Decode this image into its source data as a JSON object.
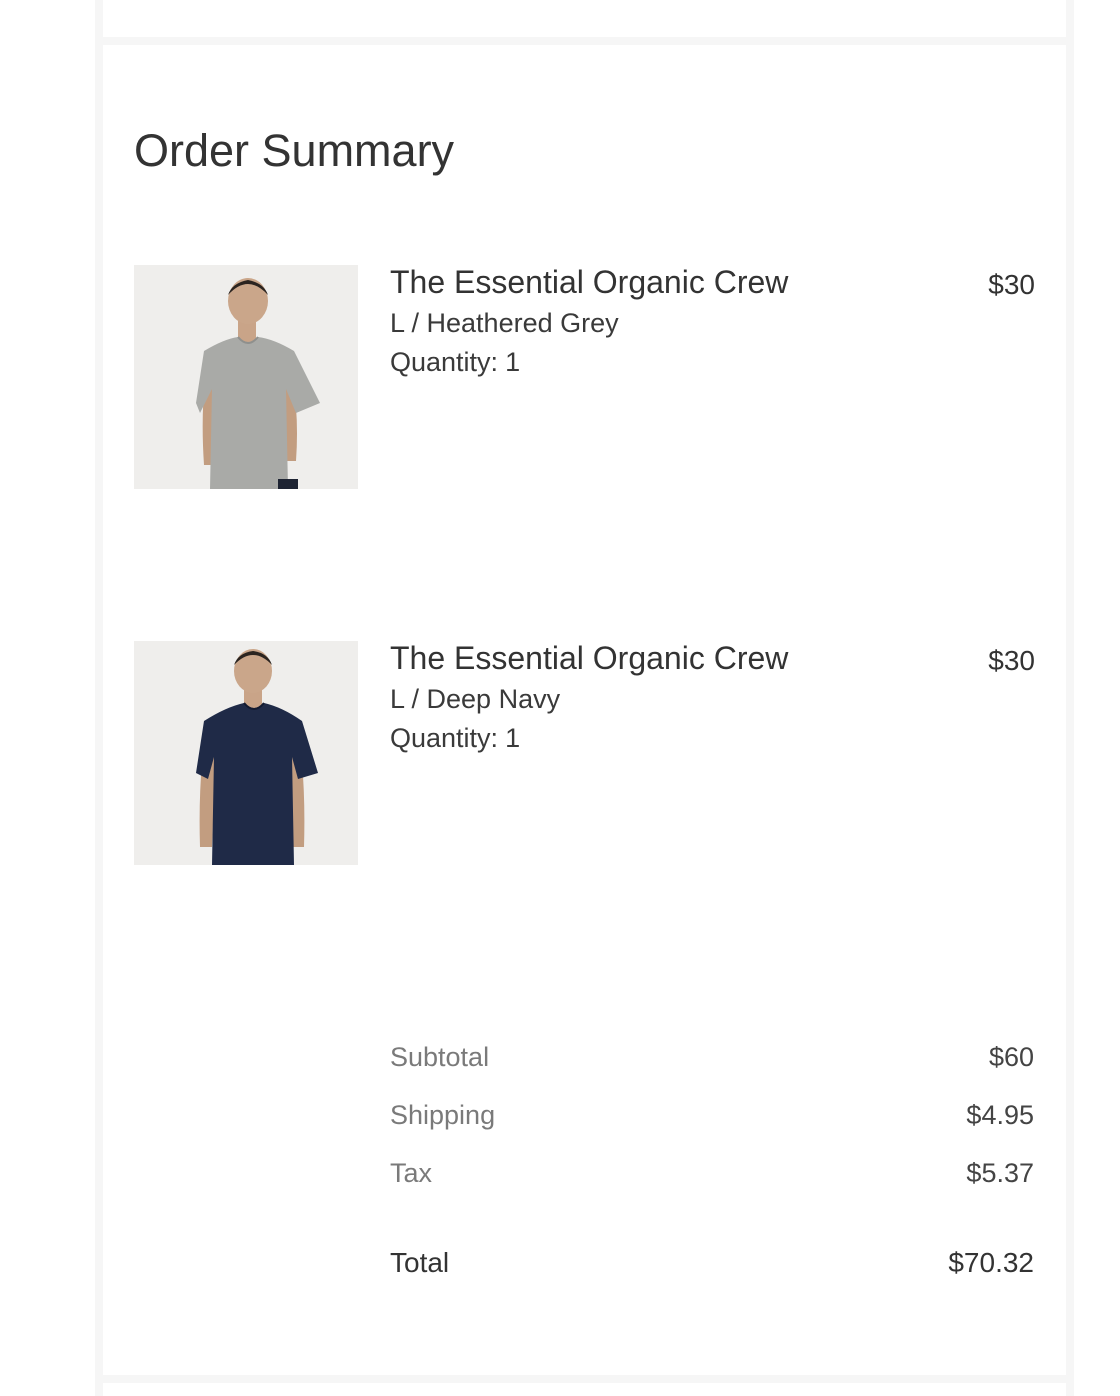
{
  "order_summary": {
    "title": "Order Summary",
    "items": [
      {
        "name": "The Essential Organic Crew",
        "variant": "L / Heathered Grey",
        "quantity_label": "Quantity:",
        "quantity": "1",
        "price": "$30",
        "image": "product-photo-grey-tshirt",
        "shirt_color": "#a9aaa7"
      },
      {
        "name": "The Essential Organic Crew",
        "variant": "L / Deep Navy",
        "quantity_label": "Quantity:",
        "quantity": "1",
        "price": "$30",
        "image": "product-photo-navy-tshirt",
        "shirt_color": "#1f2a47"
      }
    ],
    "totals": {
      "subtotal_label": "Subtotal",
      "subtotal": "$60",
      "shipping_label": "Shipping",
      "shipping": "$4.95",
      "tax_label": "Tax",
      "tax": "$5.37",
      "total_label": "Total",
      "total": "$70.32"
    }
  },
  "colors": {
    "background": "#f6f6f6",
    "card": "#ffffff",
    "text": "#333333",
    "muted_text": "#7a7a7a"
  }
}
